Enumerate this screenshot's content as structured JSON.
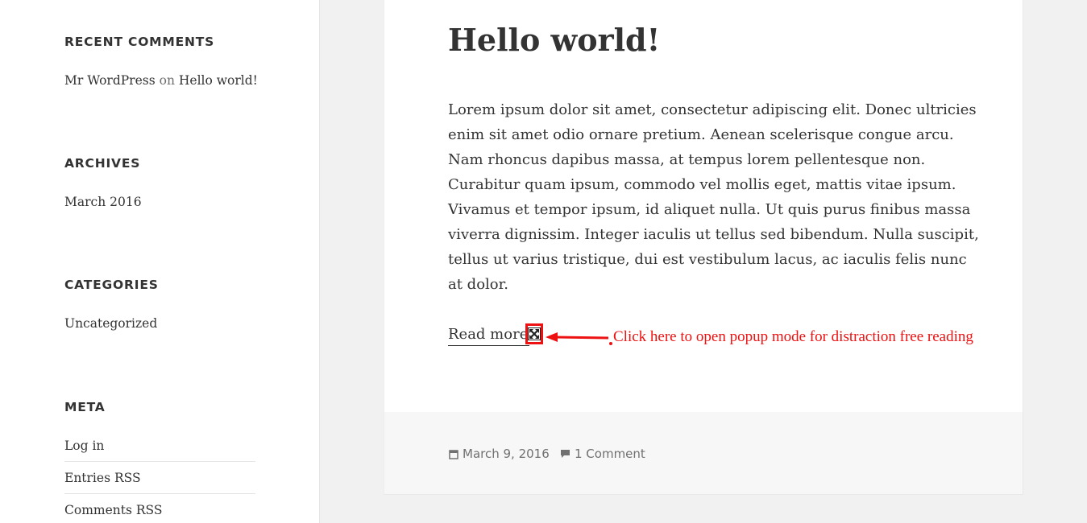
{
  "sidebar": {
    "recent_comments": {
      "title": "Recent Comments",
      "author": "Mr WordPress",
      "on": "on",
      "post": "Hello world!"
    },
    "archives": {
      "title": "Archives",
      "items": [
        "March 2016"
      ]
    },
    "categories": {
      "title": "Categories",
      "items": [
        "Uncategorized"
      ]
    },
    "meta": {
      "title": "Meta",
      "items": [
        "Log in",
        "Entries RSS",
        "Comments RSS"
      ]
    }
  },
  "post": {
    "title": "Hello world!",
    "body": "Lorem ipsum dolor sit amet, consectetur adipiscing elit. Donec ultricies enim sit amet odio ornare pretium. Aenean scelerisque congue arcu. Nam rhoncus dapibus massa, at tempus lorem pellentesque non. Curabitur quam ipsum, commodo vel mollis eget, mattis vitae ipsum. Vivamus et tempor ipsum, id aliquet nulla. Ut quis purus finibus massa viverra dignissim. Integer iaculis ut tellus sed bibendum. Nulla suscipit, tellus ut varius tristique, dui est vestibulum lacus, ac iaculis felis nunc at dolor.",
    "read_more": "Read more",
    "annotation": "Click here to open popup mode for distraction free reading",
    "date": "March 9, 2016",
    "comments": "1 Comment"
  },
  "colors": {
    "annotation_red": "#ee1111",
    "text": "#333333",
    "muted": "#707070"
  },
  "icons": {
    "expand": "expand-arrows-icon",
    "calendar": "calendar-icon",
    "comment": "comment-icon"
  }
}
